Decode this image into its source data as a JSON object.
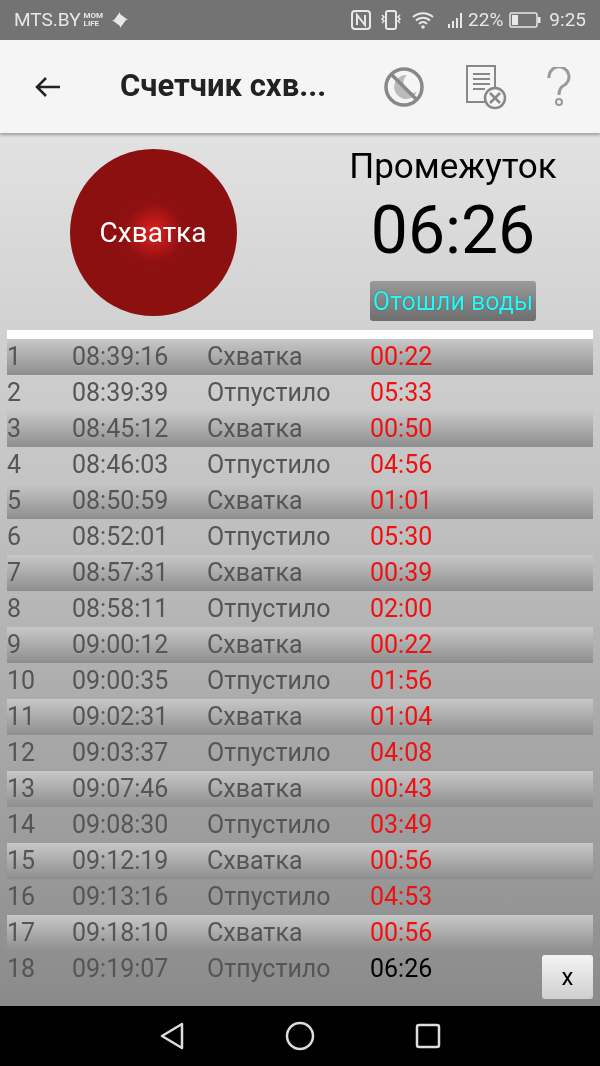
{
  "status_bar": {
    "carrier": "MTS.BY",
    "carrier_logo": "MOM LIFE",
    "battery": "22%",
    "time": "9:25"
  },
  "toolbar": {
    "title": "Счетчик схв..."
  },
  "main_button": {
    "label": "Схватка"
  },
  "interval": {
    "label": "Промежуток",
    "value": "06:26"
  },
  "water_button": {
    "label": "Отошли воды"
  },
  "rows": [
    {
      "n": "1",
      "time": "08:39:16",
      "event": "Схватка",
      "duration": "00:22",
      "ongoing": false
    },
    {
      "n": "2",
      "time": "08:39:39",
      "event": "Отпустило",
      "duration": "05:33",
      "ongoing": false
    },
    {
      "n": "3",
      "time": "08:45:12",
      "event": "Схватка",
      "duration": "00:50",
      "ongoing": false
    },
    {
      "n": "4",
      "time": "08:46:03",
      "event": "Отпустило",
      "duration": "04:56",
      "ongoing": false
    },
    {
      "n": "5",
      "time": "08:50:59",
      "event": "Схватка",
      "duration": "01:01",
      "ongoing": false
    },
    {
      "n": "6",
      "time": "08:52:01",
      "event": "Отпустило",
      "duration": "05:30",
      "ongoing": false
    },
    {
      "n": "7",
      "time": "08:57:31",
      "event": "Схватка",
      "duration": "00:39",
      "ongoing": false
    },
    {
      "n": "8",
      "time": "08:58:11",
      "event": "Отпустило",
      "duration": "02:00",
      "ongoing": false
    },
    {
      "n": "9",
      "time": "09:00:12",
      "event": "Схватка",
      "duration": "00:22",
      "ongoing": false
    },
    {
      "n": "10",
      "time": "09:00:35",
      "event": "Отпустило",
      "duration": "01:56",
      "ongoing": false
    },
    {
      "n": "11",
      "time": "09:02:31",
      "event": "Схватка",
      "duration": "01:04",
      "ongoing": false
    },
    {
      "n": "12",
      "time": "09:03:37",
      "event": "Отпустило",
      "duration": "04:08",
      "ongoing": false
    },
    {
      "n": "13",
      "time": "09:07:46",
      "event": "Схватка",
      "duration": "00:43",
      "ongoing": false
    },
    {
      "n": "14",
      "time": "09:08:30",
      "event": "Отпустило",
      "duration": "03:49",
      "ongoing": false
    },
    {
      "n": "15",
      "time": "09:12:19",
      "event": "Схватка",
      "duration": "00:56",
      "ongoing": false
    },
    {
      "n": "16",
      "time": "09:13:16",
      "event": "Отпустило",
      "duration": "04:53",
      "ongoing": false
    },
    {
      "n": "17",
      "time": "09:18:10",
      "event": "Схватка",
      "duration": "00:56",
      "ongoing": false
    },
    {
      "n": "18",
      "time": "09:19:07",
      "event": "Отпустило",
      "duration": "06:26",
      "ongoing": true
    }
  ],
  "delete_button": {
    "label": "x"
  }
}
